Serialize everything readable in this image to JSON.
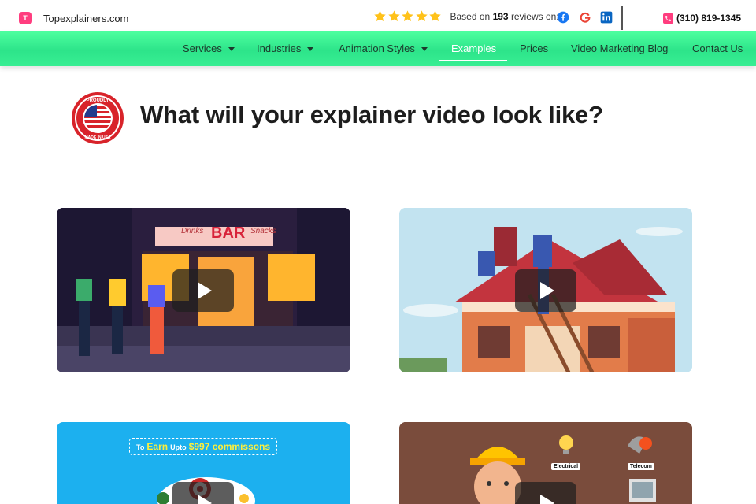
{
  "header": {
    "brand_name": "Topexplainers.com",
    "brand_logo_letter": "T",
    "reviews_prefix": "Based on",
    "reviews_count": "193",
    "reviews_suffix": "reviews on:",
    "rating_stars": 5,
    "phone": "(310) 819-1345",
    "social_icons": [
      "facebook-icon",
      "google-icon",
      "linkedin-icon"
    ]
  },
  "nav": {
    "items": [
      {
        "label": "Services",
        "dropdown": true
      },
      {
        "label": "Industries",
        "dropdown": true
      },
      {
        "label": "Animation Styles",
        "dropdown": true
      },
      {
        "label": "Examples",
        "dropdown": false,
        "active": true
      },
      {
        "label": "Prices",
        "dropdown": false
      },
      {
        "label": "Video Marketing Blog",
        "dropdown": false
      },
      {
        "label": "Contact Us",
        "dropdown": false
      }
    ]
  },
  "main": {
    "title": "What will your explainer video look like?",
    "badge": {
      "top_text": "PROUDLY",
      "bottom_text": "MADE IN USA"
    }
  },
  "videos": {
    "card1": {
      "sign": "BAR",
      "sign_left": "Drinks",
      "sign_right": "Snacks"
    },
    "card3": {
      "promo_prefix": "To",
      "promo_earn": "Earn",
      "promo_upto": "Upto",
      "promo_amount": "$997 commissons"
    },
    "card4": {
      "label_electrical": "Electrical",
      "label_telecom": "Telecom"
    }
  },
  "colors": {
    "nav_green": "#2de48a",
    "brand_pink": "#ff3d7f",
    "star_yellow": "#ffc21a",
    "facebook_blue": "#1877f2",
    "linkedin_blue": "#0a66c2"
  }
}
